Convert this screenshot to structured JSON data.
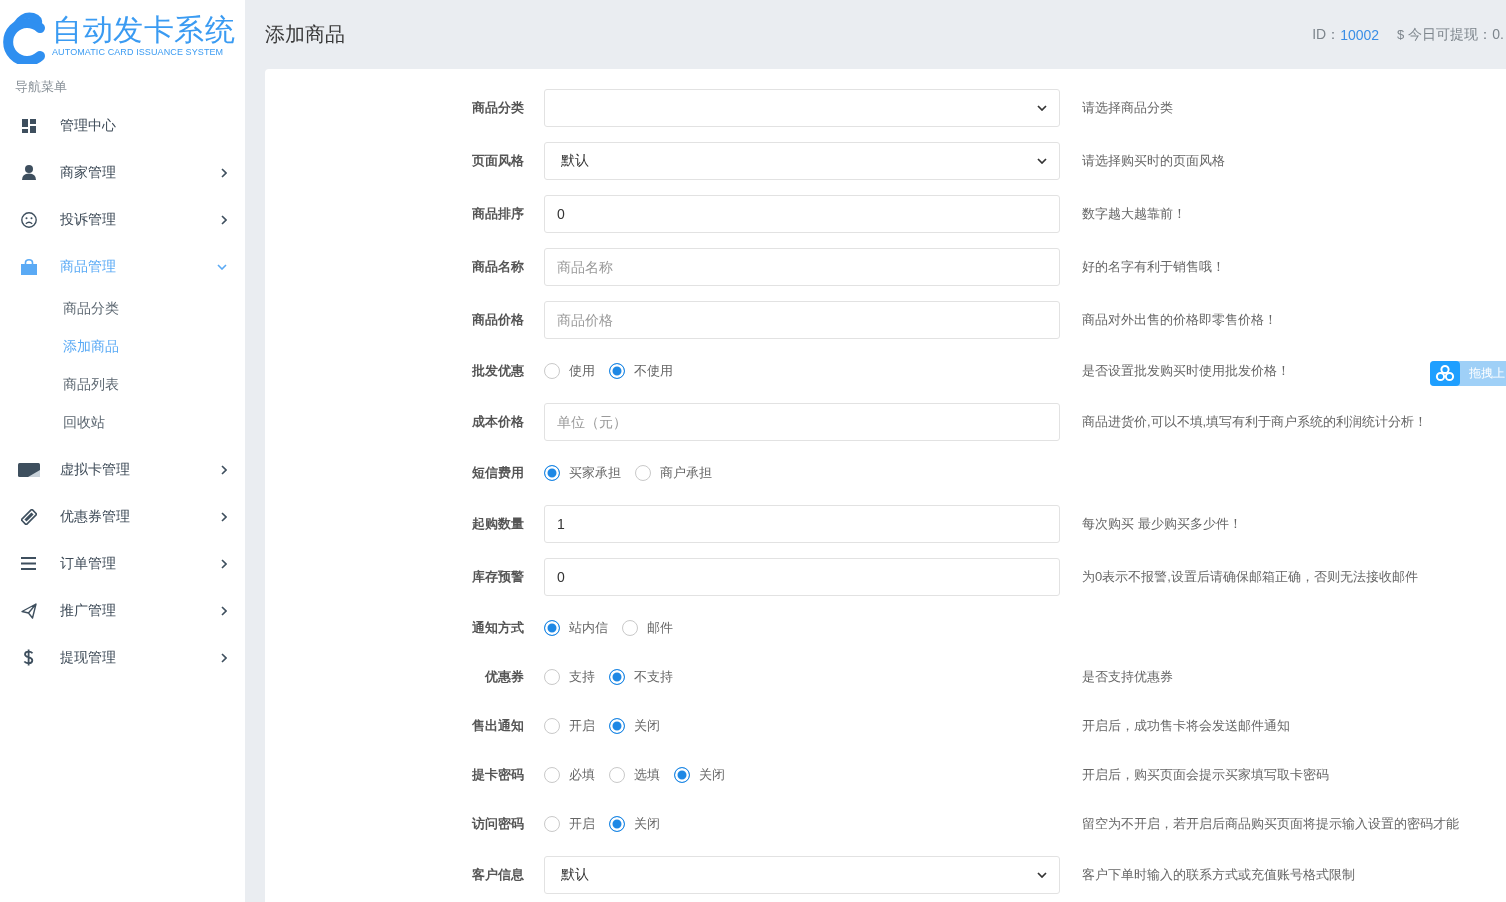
{
  "logo": {
    "title": "自动发卡系统",
    "subtitle": "AUTOMATIC CARD ISSUANCE SYSTEM"
  },
  "sidebar": {
    "heading": "导航菜单",
    "items": [
      {
        "kind": "link",
        "label": "管理中心",
        "selected": false
      },
      {
        "kind": "group",
        "label": "商家管理",
        "selected": false,
        "expanded": false
      },
      {
        "kind": "group",
        "label": "投诉管理",
        "selected": false,
        "expanded": false
      },
      {
        "kind": "group",
        "label": "商品管理",
        "selected": true,
        "expanded": true,
        "children": [
          {
            "label": "商品分类",
            "selected": false
          },
          {
            "label": "添加商品",
            "selected": true
          },
          {
            "label": "商品列表",
            "selected": false
          },
          {
            "label": "回收站",
            "selected": false
          }
        ]
      },
      {
        "kind": "group",
        "label": "虚拟卡管理",
        "selected": false,
        "expanded": false
      },
      {
        "kind": "group",
        "label": "优惠券管理",
        "selected": false,
        "expanded": false
      },
      {
        "kind": "group",
        "label": "订单管理",
        "selected": false,
        "expanded": false
      },
      {
        "kind": "group",
        "label": "推广管理",
        "selected": false,
        "expanded": false
      },
      {
        "kind": "group",
        "label": "提现管理",
        "selected": false,
        "expanded": false
      }
    ]
  },
  "header": {
    "title": "添加商品",
    "id_label": "ID：",
    "id_value": "10002",
    "currency_symbol": "$",
    "balance_label": "今日可提现：0."
  },
  "form": {
    "rows": [
      {
        "kind": "select",
        "label": "商品分类",
        "hint": "请选择商品分类"
      },
      {
        "kind": "select",
        "label": "页面风格",
        "value": "默认",
        "hint": "请选择购买时的页面风格"
      },
      {
        "kind": "input",
        "label": "商品排序",
        "value": "0",
        "hint": "数字越大越靠前！"
      },
      {
        "kind": "input",
        "label": "商品名称",
        "placeholder": "商品名称",
        "hint": "好的名字有利于销售哦！"
      },
      {
        "kind": "input",
        "label": "商品价格",
        "placeholder": "商品价格",
        "hint": "商品对外出售的价格即零售价格！"
      },
      {
        "kind": "radio",
        "label": "批发优惠",
        "options": [
          {
            "label": "使用",
            "selected": false
          },
          {
            "label": "不使用",
            "selected": true
          }
        ],
        "hint": "是否设置批发购买时使用批发价格！"
      },
      {
        "kind": "input",
        "label": "成本价格",
        "placeholder": "单位（元）",
        "hint": "商品进货价,可以不填,填写有利于商户系统的利润统计分析！"
      },
      {
        "kind": "radio",
        "label": "短信费用",
        "options": [
          {
            "label": "买家承担",
            "selected": true
          },
          {
            "label": "商户承担",
            "selected": false
          }
        ]
      },
      {
        "kind": "input",
        "label": "起购数量",
        "value": "1",
        "hint": "每次购买 最少购买多少件！"
      },
      {
        "kind": "input",
        "label": "库存预警",
        "value": "0",
        "hint": "为0表示不报警,设置后请确保邮箱正确，否则无法接收邮件"
      },
      {
        "kind": "radio",
        "label": "通知方式",
        "options": [
          {
            "label": "站内信",
            "selected": true
          },
          {
            "label": "邮件",
            "selected": false
          }
        ]
      },
      {
        "kind": "radio",
        "label": "优惠券",
        "options": [
          {
            "label": "支持",
            "selected": false
          },
          {
            "label": "不支持",
            "selected": true
          }
        ],
        "hint": "是否支持优惠券"
      },
      {
        "kind": "radio",
        "label": "售出通知",
        "options": [
          {
            "label": "开启",
            "selected": false
          },
          {
            "label": "关闭",
            "selected": true
          }
        ],
        "hint": "开启后，成功售卡将会发送邮件通知"
      },
      {
        "kind": "radio",
        "label": "提卡密码",
        "options": [
          {
            "label": "必填",
            "selected": false
          },
          {
            "label": "选填",
            "selected": false
          },
          {
            "label": "关闭",
            "selected": true
          }
        ],
        "hint": "开启后，购买页面会提示买家填写取卡密码"
      },
      {
        "kind": "radio",
        "label": "访问密码",
        "options": [
          {
            "label": "开启",
            "selected": false
          },
          {
            "label": "关闭",
            "selected": true
          }
        ],
        "hint": "留空为不开启，若开启后商品购买页面将提示输入设置的密码才能"
      },
      {
        "kind": "select",
        "label": "客户信息",
        "value": "默认",
        "hint": "客户下单时输入的联系方式或充值账号格式限制"
      }
    ]
  },
  "upload_button": {
    "label": "拖拽上"
  }
}
